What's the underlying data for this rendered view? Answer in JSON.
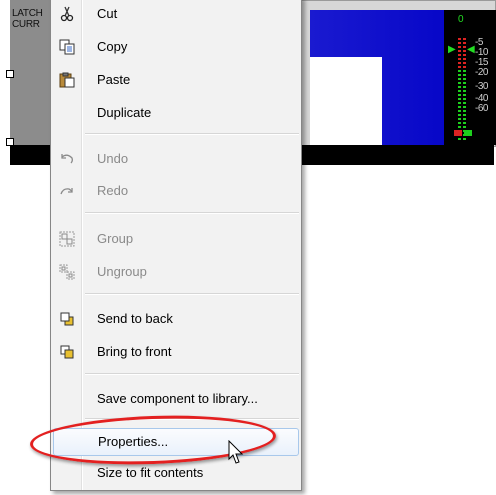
{
  "background": {
    "component_label_lines": [
      "LATCH",
      "CURR"
    ],
    "meter": {
      "zero_label": "0",
      "scale_ticks": [
        "-5",
        "-10",
        "-15",
        "-20",
        "-30",
        "-40",
        "-60"
      ]
    }
  },
  "menu": {
    "items": [
      {
        "label": "Cut",
        "icon": "scissors-icon",
        "enabled": true
      },
      {
        "label": "Copy",
        "icon": "copy-icon",
        "enabled": true
      },
      {
        "label": "Paste",
        "icon": "paste-icon",
        "enabled": true
      },
      {
        "label": "Duplicate",
        "icon": "",
        "enabled": true
      },
      {
        "label": "Undo",
        "icon": "undo-icon",
        "enabled": false
      },
      {
        "label": "Redo",
        "icon": "redo-icon",
        "enabled": false
      },
      {
        "label": "Group",
        "icon": "group-icon",
        "enabled": false
      },
      {
        "label": "Ungroup",
        "icon": "ungroup-icon",
        "enabled": false
      },
      {
        "label": "Send to back",
        "icon": "send-to-back-icon",
        "enabled": true
      },
      {
        "label": "Bring to front",
        "icon": "bring-to-front-icon",
        "enabled": true
      },
      {
        "label": "Save component to library...",
        "icon": "",
        "enabled": true
      },
      {
        "label": "Properties...",
        "icon": "",
        "enabled": true,
        "highlighted": true
      },
      {
        "label": "Size to fit contents",
        "icon": "",
        "enabled": true
      }
    ]
  },
  "annotation": {
    "color": "#e32020",
    "shape": "ellipse around Properties..."
  },
  "colors": {
    "menu_bg": "#f2f2f2",
    "highlight_border": "#a8c8eb",
    "component_blue": "#0b0bd8",
    "meter_green": "#1dcf1d"
  }
}
